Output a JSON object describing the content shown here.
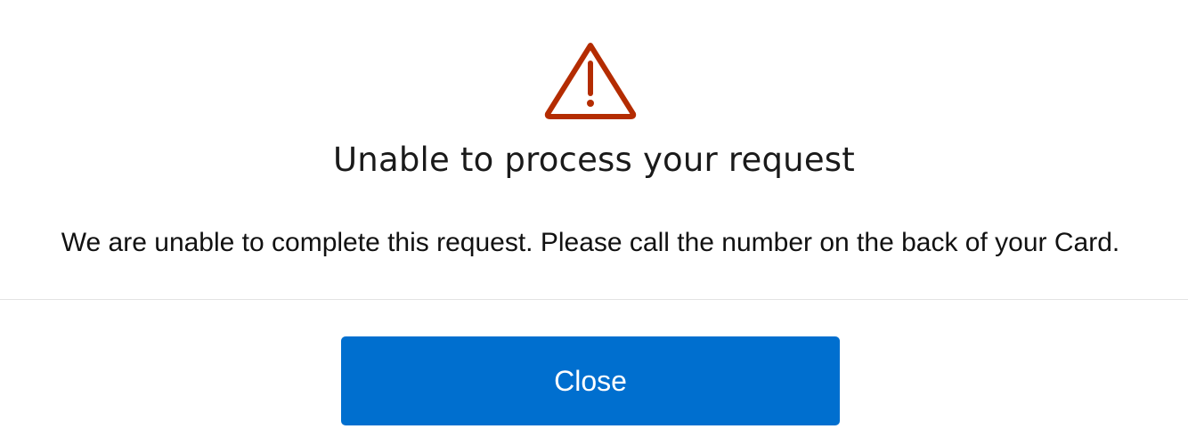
{
  "dialog": {
    "icon": "warning-triangle-icon",
    "icon_color": "#b42c01",
    "title": "Unable to process your request",
    "message": "We are unable to complete this request. Please call the number on the back of your Card.",
    "close_label": "Close",
    "button_color": "#006fcf"
  }
}
